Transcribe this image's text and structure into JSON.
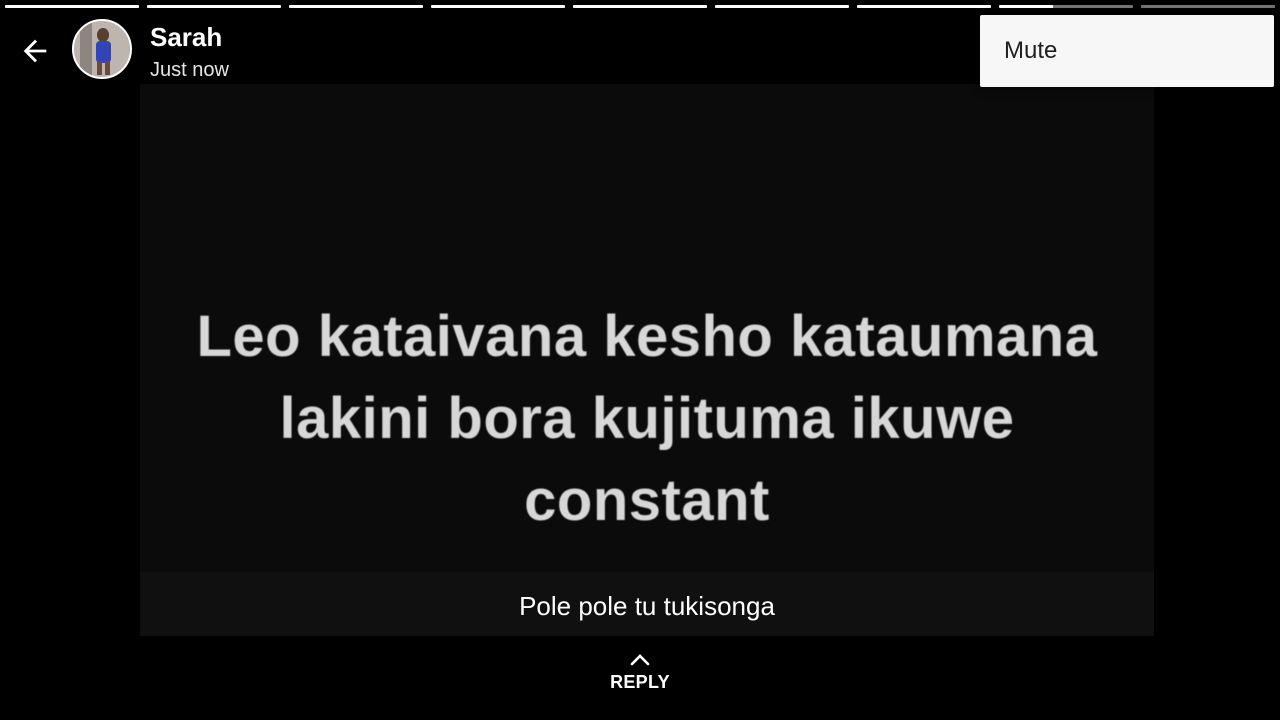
{
  "story_progress": {
    "segments": [
      1,
      1,
      1,
      1,
      1,
      1,
      1,
      0.4,
      0
    ]
  },
  "header": {
    "back_icon": "arrow-left-icon",
    "user_name": "Sarah",
    "timestamp": "Just now"
  },
  "status": {
    "text_lines": [
      "Leo kataivana kesho kataumana",
      "lakini bora kujituma ikuwe",
      "constant"
    ],
    "caption": "Pole pole tu tukisonga"
  },
  "reply": {
    "icon": "chevron-up-icon",
    "label": "REPLY"
  },
  "menu": {
    "items": [
      {
        "label": "Mute"
      }
    ]
  },
  "colors": {
    "background": "#000000",
    "menu_background": "#f7f7f7",
    "text": "#ffffff"
  }
}
